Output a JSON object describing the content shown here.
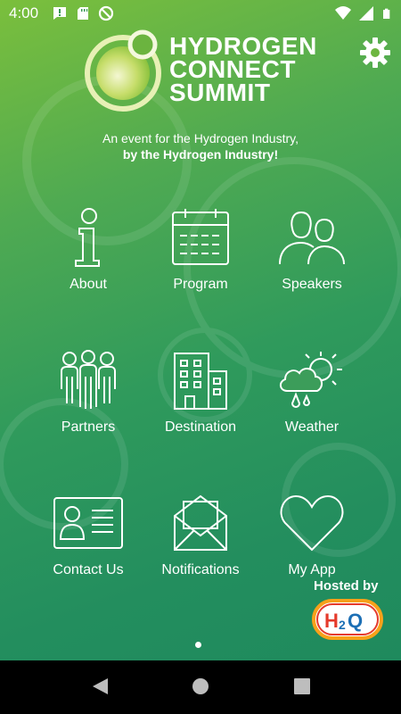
{
  "status_bar": {
    "time": "4:00",
    "left_icons": [
      "alert-notification-icon",
      "sd-card-icon",
      "do-not-disturb-icon"
    ],
    "right_icons": [
      "wifi-icon",
      "cell-signal-icon",
      "battery-icon"
    ]
  },
  "header": {
    "logo_lines": [
      "HYDROGEN",
      "CONNECT",
      "SUMMIT"
    ],
    "settings_icon": "gear-icon"
  },
  "tagline": {
    "line1": "An event for the Hydrogen Industry,",
    "line2": "by the Hydrogen Industry!"
  },
  "menu": {
    "items": [
      {
        "label": "About",
        "icon": "info-icon"
      },
      {
        "label": "Program",
        "icon": "calendar-icon"
      },
      {
        "label": "Speakers",
        "icon": "people-icon"
      },
      {
        "label": "Partners",
        "icon": "group-icon"
      },
      {
        "label": "Destination",
        "icon": "building-icon"
      },
      {
        "label": "Weather",
        "icon": "weather-icon"
      },
      {
        "label": "Contact Us",
        "icon": "id-card-icon"
      },
      {
        "label": "Notifications",
        "icon": "envelope-icon"
      },
      {
        "label": "My App",
        "icon": "heart-icon"
      }
    ]
  },
  "footer": {
    "hosted_by": "Hosted by",
    "host_logo": "H2Q"
  },
  "colors": {
    "gradient_top": "#7bbf3c",
    "gradient_bottom": "#1f8a5d",
    "text": "#ffffff"
  }
}
